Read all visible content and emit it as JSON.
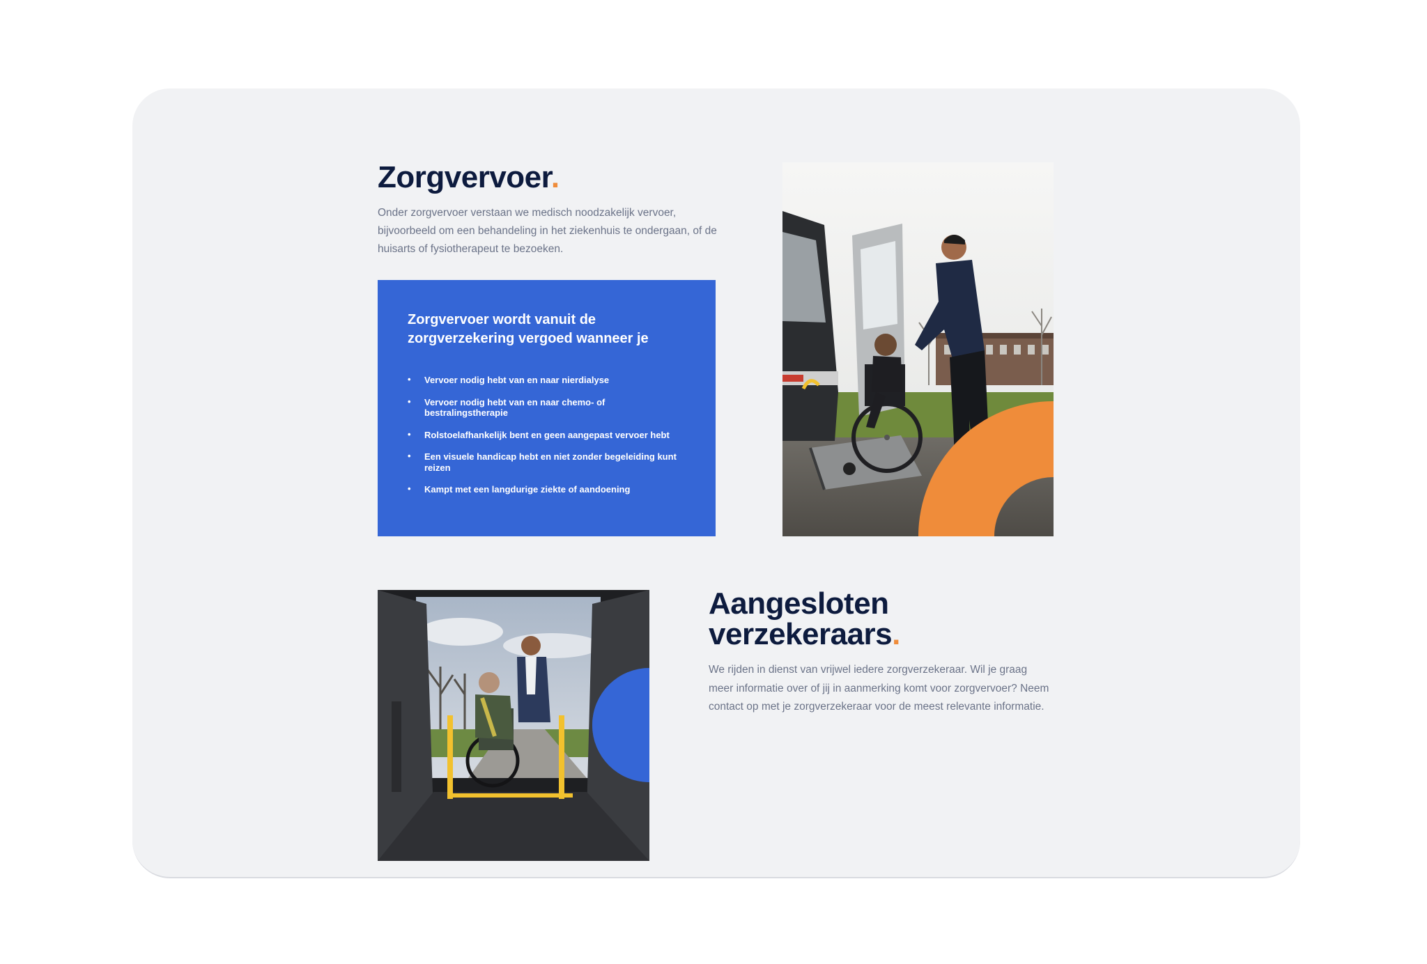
{
  "section1": {
    "title": "Zorgvervoer",
    "title_dot": ".",
    "intro": "Onder zorgvervoer verstaan we medisch noodzakelijk vervoer, bijvoorbeeld om een behandeling in het ziekenhuis te ondergaan, of de huisarts of fysiotherapeut te bezoeken.",
    "box": {
      "heading": "Zorgvervoer wordt vanuit de zorgverzekering vergoed wanneer je",
      "bullet": "•",
      "items": [
        "Vervoer nodig hebt van en naar nierdialyse",
        "Vervoer nodig hebt van en naar chemo- of bestralingstherapie",
        "Rolstoelafhankelijk bent en geen aangepast vervoer hebt",
        "Een visuele handicap hebt en niet zonder begeleiding kunt reizen",
        "Kampt met een langdurige ziekte of aandoening"
      ]
    }
  },
  "section2": {
    "title": "Aangesloten verzekeraars",
    "title_dot": ".",
    "body": "We rijden in dienst van vrijwel iedere zorgverzekeraar. Wil je graag meer informatie over of jij in aanmerking komt voor zorgvervoer? Neem contact op met je zorgverzekeraar voor de meest relevante informatie."
  },
  "colors": {
    "page_bg": "#ffffff",
    "card_bg": "#f1f2f4",
    "heading": "#0d1b3e",
    "body_text": "#6b7388",
    "accent_blue": "#3566d6",
    "accent_orange": "#ef8c3a"
  },
  "images": {
    "photo1": "wheelchair-van-lift-photo",
    "photo2": "van-interior-wheelchair-photo"
  }
}
